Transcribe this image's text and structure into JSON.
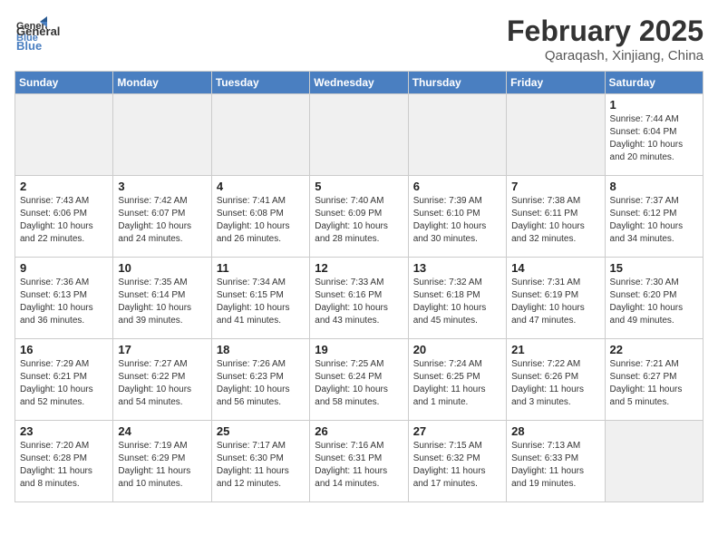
{
  "header": {
    "logo_general": "General",
    "logo_blue": "Blue",
    "month_title": "February 2025",
    "location": "Qaraqash, Xinjiang, China"
  },
  "weekdays": [
    "Sunday",
    "Monday",
    "Tuesday",
    "Wednesday",
    "Thursday",
    "Friday",
    "Saturday"
  ],
  "weeks": [
    [
      {
        "day": "",
        "info": ""
      },
      {
        "day": "",
        "info": ""
      },
      {
        "day": "",
        "info": ""
      },
      {
        "day": "",
        "info": ""
      },
      {
        "day": "",
        "info": ""
      },
      {
        "day": "",
        "info": ""
      },
      {
        "day": "1",
        "info": "Sunrise: 7:44 AM\nSunset: 6:04 PM\nDaylight: 10 hours and 20 minutes."
      }
    ],
    [
      {
        "day": "2",
        "info": "Sunrise: 7:43 AM\nSunset: 6:06 PM\nDaylight: 10 hours and 22 minutes."
      },
      {
        "day": "3",
        "info": "Sunrise: 7:42 AM\nSunset: 6:07 PM\nDaylight: 10 hours and 24 minutes."
      },
      {
        "day": "4",
        "info": "Sunrise: 7:41 AM\nSunset: 6:08 PM\nDaylight: 10 hours and 26 minutes."
      },
      {
        "day": "5",
        "info": "Sunrise: 7:40 AM\nSunset: 6:09 PM\nDaylight: 10 hours and 28 minutes."
      },
      {
        "day": "6",
        "info": "Sunrise: 7:39 AM\nSunset: 6:10 PM\nDaylight: 10 hours and 30 minutes."
      },
      {
        "day": "7",
        "info": "Sunrise: 7:38 AM\nSunset: 6:11 PM\nDaylight: 10 hours and 32 minutes."
      },
      {
        "day": "8",
        "info": "Sunrise: 7:37 AM\nSunset: 6:12 PM\nDaylight: 10 hours and 34 minutes."
      }
    ],
    [
      {
        "day": "9",
        "info": "Sunrise: 7:36 AM\nSunset: 6:13 PM\nDaylight: 10 hours and 36 minutes."
      },
      {
        "day": "10",
        "info": "Sunrise: 7:35 AM\nSunset: 6:14 PM\nDaylight: 10 hours and 39 minutes."
      },
      {
        "day": "11",
        "info": "Sunrise: 7:34 AM\nSunset: 6:15 PM\nDaylight: 10 hours and 41 minutes."
      },
      {
        "day": "12",
        "info": "Sunrise: 7:33 AM\nSunset: 6:16 PM\nDaylight: 10 hours and 43 minutes."
      },
      {
        "day": "13",
        "info": "Sunrise: 7:32 AM\nSunset: 6:18 PM\nDaylight: 10 hours and 45 minutes."
      },
      {
        "day": "14",
        "info": "Sunrise: 7:31 AM\nSunset: 6:19 PM\nDaylight: 10 hours and 47 minutes."
      },
      {
        "day": "15",
        "info": "Sunrise: 7:30 AM\nSunset: 6:20 PM\nDaylight: 10 hours and 49 minutes."
      }
    ],
    [
      {
        "day": "16",
        "info": "Sunrise: 7:29 AM\nSunset: 6:21 PM\nDaylight: 10 hours and 52 minutes."
      },
      {
        "day": "17",
        "info": "Sunrise: 7:27 AM\nSunset: 6:22 PM\nDaylight: 10 hours and 54 minutes."
      },
      {
        "day": "18",
        "info": "Sunrise: 7:26 AM\nSunset: 6:23 PM\nDaylight: 10 hours and 56 minutes."
      },
      {
        "day": "19",
        "info": "Sunrise: 7:25 AM\nSunset: 6:24 PM\nDaylight: 10 hours and 58 minutes."
      },
      {
        "day": "20",
        "info": "Sunrise: 7:24 AM\nSunset: 6:25 PM\nDaylight: 11 hours and 1 minute."
      },
      {
        "day": "21",
        "info": "Sunrise: 7:22 AM\nSunset: 6:26 PM\nDaylight: 11 hours and 3 minutes."
      },
      {
        "day": "22",
        "info": "Sunrise: 7:21 AM\nSunset: 6:27 PM\nDaylight: 11 hours and 5 minutes."
      }
    ],
    [
      {
        "day": "23",
        "info": "Sunrise: 7:20 AM\nSunset: 6:28 PM\nDaylight: 11 hours and 8 minutes."
      },
      {
        "day": "24",
        "info": "Sunrise: 7:19 AM\nSunset: 6:29 PM\nDaylight: 11 hours and 10 minutes."
      },
      {
        "day": "25",
        "info": "Sunrise: 7:17 AM\nSunset: 6:30 PM\nDaylight: 11 hours and 12 minutes."
      },
      {
        "day": "26",
        "info": "Sunrise: 7:16 AM\nSunset: 6:31 PM\nDaylight: 11 hours and 14 minutes."
      },
      {
        "day": "27",
        "info": "Sunrise: 7:15 AM\nSunset: 6:32 PM\nDaylight: 11 hours and 17 minutes."
      },
      {
        "day": "28",
        "info": "Sunrise: 7:13 AM\nSunset: 6:33 PM\nDaylight: 11 hours and 19 minutes."
      },
      {
        "day": "",
        "info": ""
      }
    ]
  ]
}
